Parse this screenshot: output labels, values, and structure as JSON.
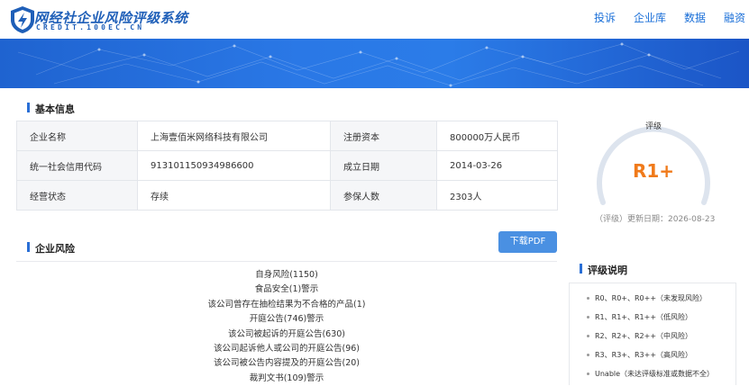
{
  "brand": {
    "title": "网经社企业风险评级系统",
    "subtitle": "CREDIT.100EC.CN",
    "accent": "#1f5fb8"
  },
  "nav": [
    "投诉",
    "企业库",
    "数据",
    "融资"
  ],
  "basic_info": {
    "section_title": "基本信息",
    "rows": [
      {
        "k1": "企业名称",
        "v1": "上海壹佰米网络科技有限公司",
        "k2": "注册资本",
        "v2": "800000万人民币"
      },
      {
        "k1": "统一社会信用代码",
        "v1": "913101150934986600",
        "k2": "成立日期",
        "v2": "2014-03-26"
      },
      {
        "k1": "经营状态",
        "v1": "存续",
        "k2": "参保人数",
        "v2": "2303人"
      }
    ]
  },
  "rating": {
    "label": "评级",
    "value": "R1+",
    "value_color": "#f07a1a",
    "update_text": "（评级）更新日期：2026-08-23"
  },
  "risk": {
    "section_title": "企业风险",
    "download_label": "下载PDF",
    "items": [
      "自身风险(1150)",
      "食品安全(1)警示",
      "该公司曾存在抽检结果为不合格的产品(1)",
      "开庭公告(746)警示",
      "该公司被起诉的开庭公告(630)",
      "该公司起诉他人或公司的开庭公告(96)",
      "该公司被公告内容提及的开庭公告(20)",
      "裁判文书(109)警示"
    ]
  },
  "rating_legend": {
    "section_title": "评级说明",
    "items": [
      "R0、R0+、R0++（未发现风险）",
      "R1、R1+、R1++（低风险）",
      "R2、R2+、R2++（中风险）",
      "R3、R3+、R3++（高风险）",
      "Unable（未达评级标准或数据不全）"
    ]
  }
}
